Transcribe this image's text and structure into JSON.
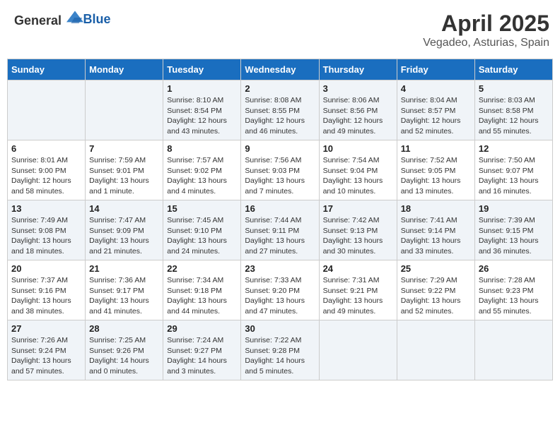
{
  "header": {
    "logo_general": "General",
    "logo_blue": "Blue",
    "title": "April 2025",
    "subtitle": "Vegadeo, Asturias, Spain"
  },
  "days_of_week": [
    "Sunday",
    "Monday",
    "Tuesday",
    "Wednesday",
    "Thursday",
    "Friday",
    "Saturday"
  ],
  "weeks": [
    {
      "days": [
        {
          "number": "",
          "info": ""
        },
        {
          "number": "",
          "info": ""
        },
        {
          "number": "1",
          "info": "Sunrise: 8:10 AM\nSunset: 8:54 PM\nDaylight: 12 hours and 43 minutes."
        },
        {
          "number": "2",
          "info": "Sunrise: 8:08 AM\nSunset: 8:55 PM\nDaylight: 12 hours and 46 minutes."
        },
        {
          "number": "3",
          "info": "Sunrise: 8:06 AM\nSunset: 8:56 PM\nDaylight: 12 hours and 49 minutes."
        },
        {
          "number": "4",
          "info": "Sunrise: 8:04 AM\nSunset: 8:57 PM\nDaylight: 12 hours and 52 minutes."
        },
        {
          "number": "5",
          "info": "Sunrise: 8:03 AM\nSunset: 8:58 PM\nDaylight: 12 hours and 55 minutes."
        }
      ]
    },
    {
      "days": [
        {
          "number": "6",
          "info": "Sunrise: 8:01 AM\nSunset: 9:00 PM\nDaylight: 12 hours and 58 minutes."
        },
        {
          "number": "7",
          "info": "Sunrise: 7:59 AM\nSunset: 9:01 PM\nDaylight: 13 hours and 1 minute."
        },
        {
          "number": "8",
          "info": "Sunrise: 7:57 AM\nSunset: 9:02 PM\nDaylight: 13 hours and 4 minutes."
        },
        {
          "number": "9",
          "info": "Sunrise: 7:56 AM\nSunset: 9:03 PM\nDaylight: 13 hours and 7 minutes."
        },
        {
          "number": "10",
          "info": "Sunrise: 7:54 AM\nSunset: 9:04 PM\nDaylight: 13 hours and 10 minutes."
        },
        {
          "number": "11",
          "info": "Sunrise: 7:52 AM\nSunset: 9:05 PM\nDaylight: 13 hours and 13 minutes."
        },
        {
          "number": "12",
          "info": "Sunrise: 7:50 AM\nSunset: 9:07 PM\nDaylight: 13 hours and 16 minutes."
        }
      ]
    },
    {
      "days": [
        {
          "number": "13",
          "info": "Sunrise: 7:49 AM\nSunset: 9:08 PM\nDaylight: 13 hours and 18 minutes."
        },
        {
          "number": "14",
          "info": "Sunrise: 7:47 AM\nSunset: 9:09 PM\nDaylight: 13 hours and 21 minutes."
        },
        {
          "number": "15",
          "info": "Sunrise: 7:45 AM\nSunset: 9:10 PM\nDaylight: 13 hours and 24 minutes."
        },
        {
          "number": "16",
          "info": "Sunrise: 7:44 AM\nSunset: 9:11 PM\nDaylight: 13 hours and 27 minutes."
        },
        {
          "number": "17",
          "info": "Sunrise: 7:42 AM\nSunset: 9:13 PM\nDaylight: 13 hours and 30 minutes."
        },
        {
          "number": "18",
          "info": "Sunrise: 7:41 AM\nSunset: 9:14 PM\nDaylight: 13 hours and 33 minutes."
        },
        {
          "number": "19",
          "info": "Sunrise: 7:39 AM\nSunset: 9:15 PM\nDaylight: 13 hours and 36 minutes."
        }
      ]
    },
    {
      "days": [
        {
          "number": "20",
          "info": "Sunrise: 7:37 AM\nSunset: 9:16 PM\nDaylight: 13 hours and 38 minutes."
        },
        {
          "number": "21",
          "info": "Sunrise: 7:36 AM\nSunset: 9:17 PM\nDaylight: 13 hours and 41 minutes."
        },
        {
          "number": "22",
          "info": "Sunrise: 7:34 AM\nSunset: 9:18 PM\nDaylight: 13 hours and 44 minutes."
        },
        {
          "number": "23",
          "info": "Sunrise: 7:33 AM\nSunset: 9:20 PM\nDaylight: 13 hours and 47 minutes."
        },
        {
          "number": "24",
          "info": "Sunrise: 7:31 AM\nSunset: 9:21 PM\nDaylight: 13 hours and 49 minutes."
        },
        {
          "number": "25",
          "info": "Sunrise: 7:29 AM\nSunset: 9:22 PM\nDaylight: 13 hours and 52 minutes."
        },
        {
          "number": "26",
          "info": "Sunrise: 7:28 AM\nSunset: 9:23 PM\nDaylight: 13 hours and 55 minutes."
        }
      ]
    },
    {
      "days": [
        {
          "number": "27",
          "info": "Sunrise: 7:26 AM\nSunset: 9:24 PM\nDaylight: 13 hours and 57 minutes."
        },
        {
          "number": "28",
          "info": "Sunrise: 7:25 AM\nSunset: 9:26 PM\nDaylight: 14 hours and 0 minutes."
        },
        {
          "number": "29",
          "info": "Sunrise: 7:24 AM\nSunset: 9:27 PM\nDaylight: 14 hours and 3 minutes."
        },
        {
          "number": "30",
          "info": "Sunrise: 7:22 AM\nSunset: 9:28 PM\nDaylight: 14 hours and 5 minutes."
        },
        {
          "number": "",
          "info": ""
        },
        {
          "number": "",
          "info": ""
        },
        {
          "number": "",
          "info": ""
        }
      ]
    }
  ]
}
